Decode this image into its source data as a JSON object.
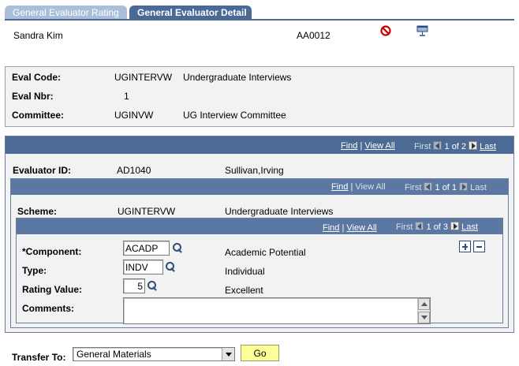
{
  "tabs": [
    {
      "label": "General Evaluator Rating",
      "active": false
    },
    {
      "label": "General Evaluator Detail",
      "active": true
    }
  ],
  "header": {
    "person_name": "Sandra Kim",
    "id": "AA0012",
    "icons": [
      "no-entry-icon",
      "monitor-icon"
    ]
  },
  "eval_box": {
    "code_label": "Eval Code:",
    "code_value": "UGINTERVW",
    "code_desc": "Undergraduate Interviews",
    "nbr_label": "Eval Nbr:",
    "nbr_value": "1",
    "committee_label": "Committee:",
    "committee_value": "UGINVW",
    "committee_desc": "UG Interview Committee"
  },
  "evaluator_nav": {
    "find": "Find",
    "sep": "|",
    "view_all": "View All",
    "first": "First",
    "range": "1 of 2",
    "last": "Last"
  },
  "evaluator": {
    "id_label": "Evaluator ID:",
    "id_value": "AD1040",
    "name": "Sullivan,Irving"
  },
  "scheme_nav": {
    "find": "Find",
    "sep": "|",
    "view_all": "View All",
    "first": "First",
    "range": "1 of 1",
    "last": "Last"
  },
  "scheme": {
    "label": "Scheme:",
    "value": "UGINTERVW",
    "desc": "Undergraduate Interviews"
  },
  "component_nav": {
    "find": "Find",
    "sep": "|",
    "view_all": "View All",
    "first": "First",
    "range": "1 of 3",
    "last": "Last"
  },
  "component": {
    "component_label": "*Component:",
    "component_value": "ACADP",
    "component_desc": "Academic Potential",
    "type_label": "Type:",
    "type_value": "INDV",
    "type_desc": "Individual",
    "rating_label": "Rating Value:",
    "rating_value": "5",
    "rating_desc": "Excellent",
    "comments_label": "Comments:",
    "comments_value": ""
  },
  "footer": {
    "transfer_label": "Transfer To:",
    "transfer_selected": "General Materials",
    "go_label": "Go"
  },
  "colors": {
    "tab_active": "#4a6a95",
    "tab_inactive": "#a9bfd9",
    "navbar": "#4b6a94",
    "go_button": "#ffff99",
    "link": "#000080"
  }
}
